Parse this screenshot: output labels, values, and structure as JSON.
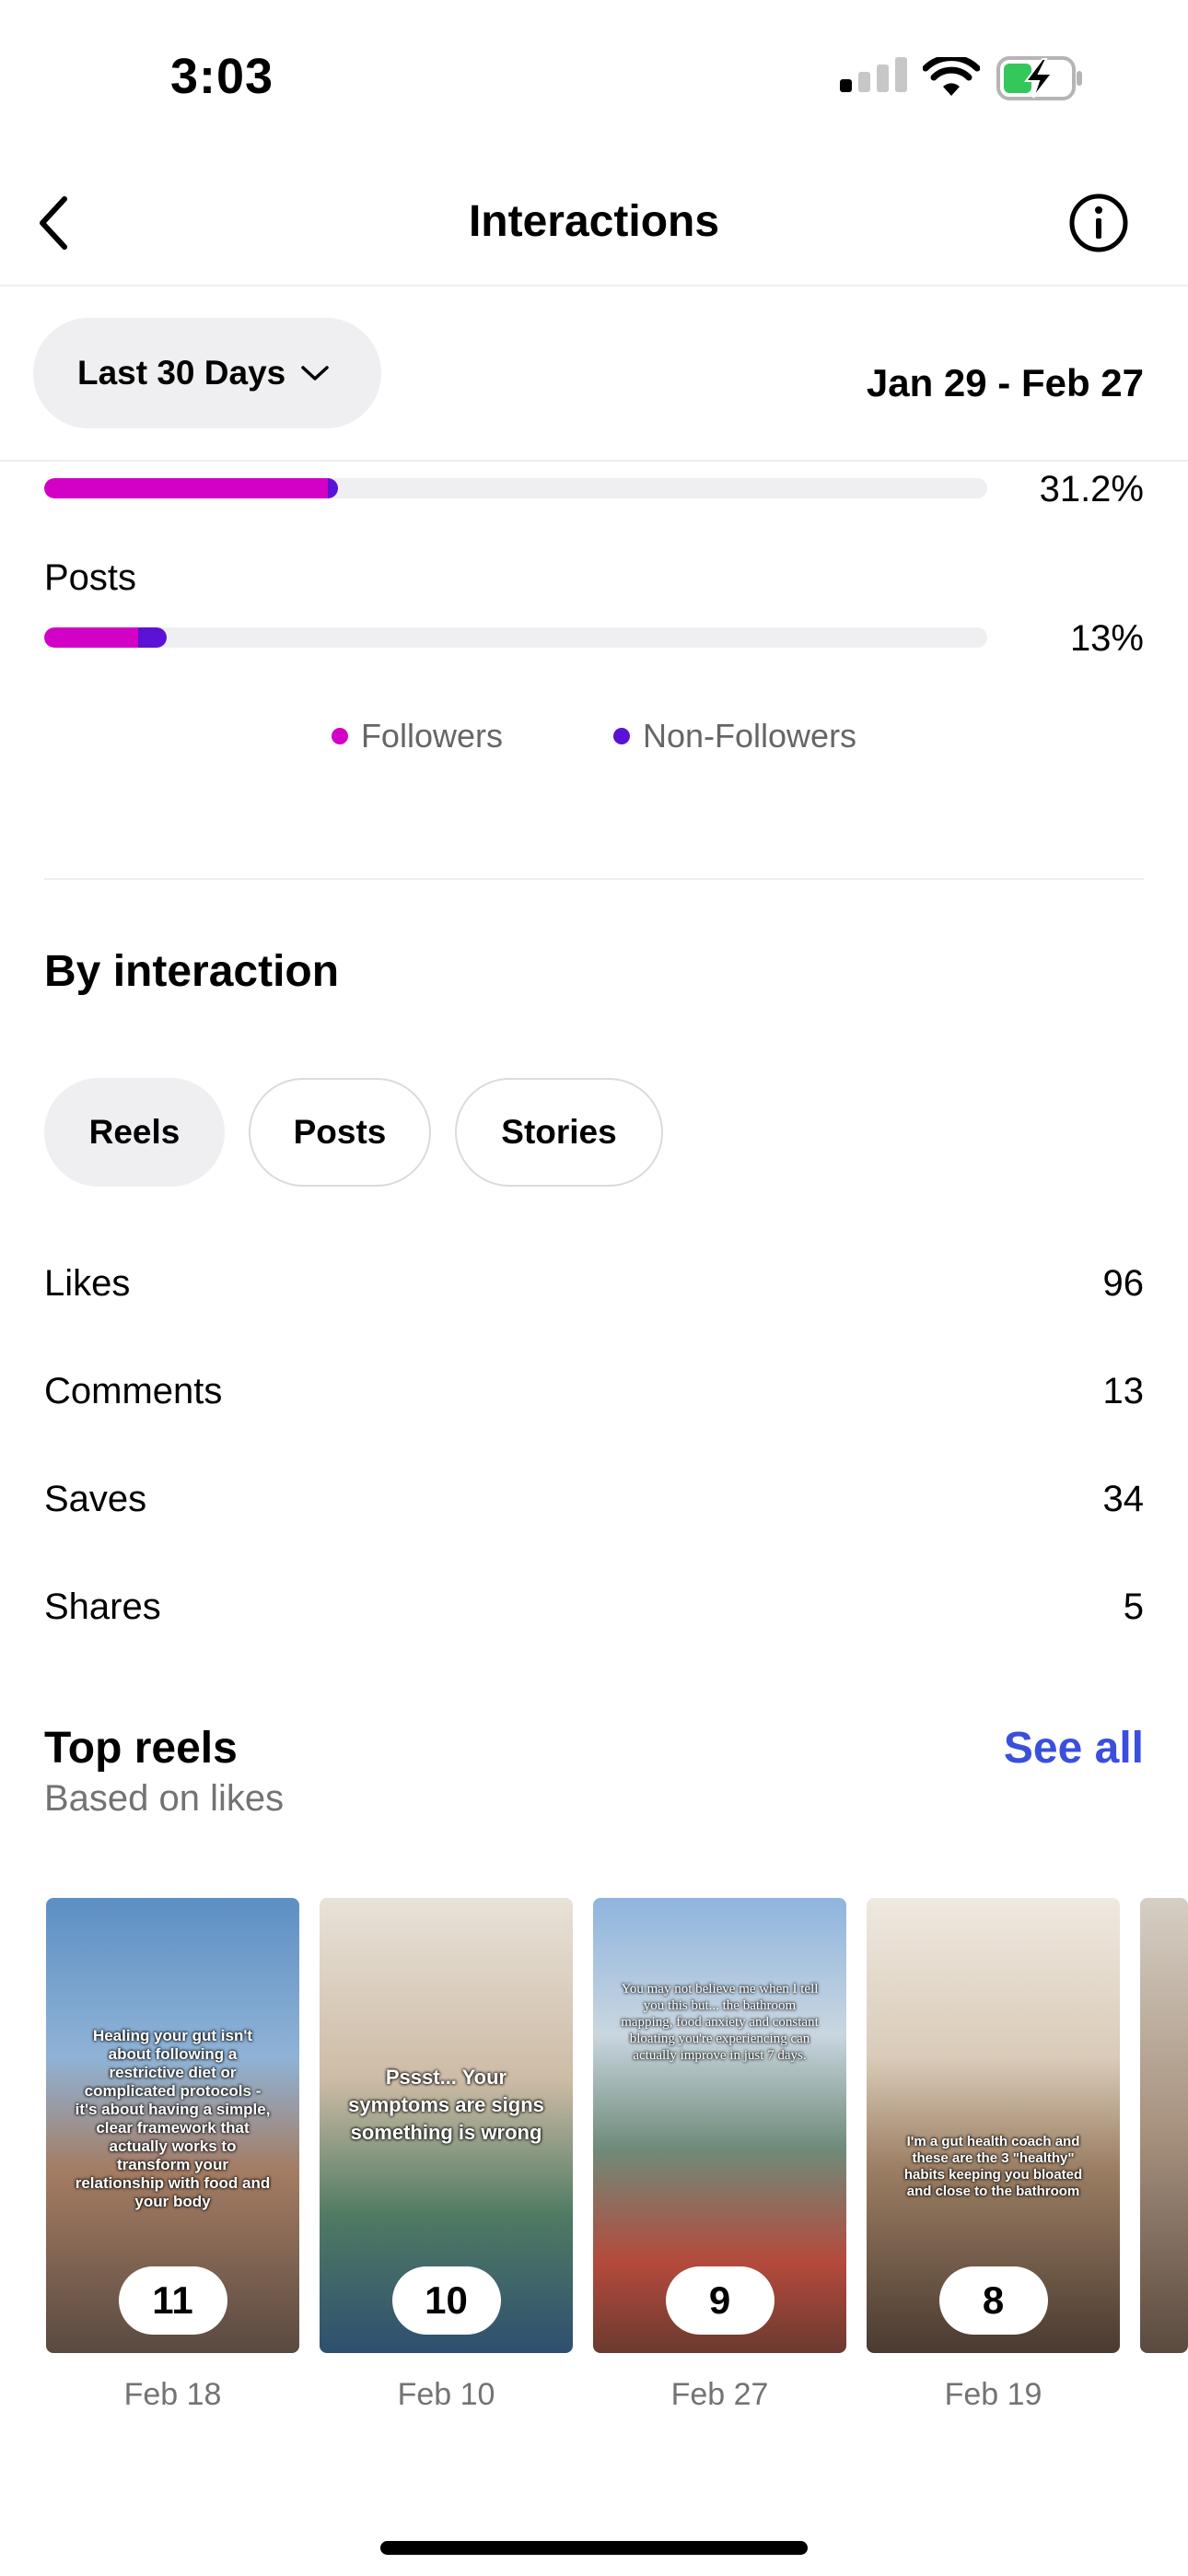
{
  "status_bar": {
    "time": "3:03"
  },
  "header": {
    "title": "Interactions"
  },
  "filter": {
    "period_label": "Last 30 Days",
    "date_range": "Jan 29 - Feb 27"
  },
  "audience_bars": [
    {
      "label": "",
      "followers_pct": 30.1,
      "non_followers_pct": 1.1,
      "total_text": "31.2%"
    },
    {
      "label": "Posts",
      "followers_pct": 10,
      "non_followers_pct": 3,
      "total_text": "13%"
    }
  ],
  "legend": {
    "followers": "Followers",
    "non_followers": "Non-Followers"
  },
  "colors": {
    "followers": "#d300c5",
    "non_followers": "#5b12d6",
    "link": "#3a4fdc",
    "track": "#efeff2"
  },
  "by_interaction": {
    "title": "By interaction",
    "tabs": [
      {
        "label": "Reels",
        "active": true
      },
      {
        "label": "Posts",
        "active": false
      },
      {
        "label": "Stories",
        "active": false
      }
    ],
    "metrics": [
      {
        "label": "Likes",
        "value": "96"
      },
      {
        "label": "Comments",
        "value": "13"
      },
      {
        "label": "Saves",
        "value": "34"
      },
      {
        "label": "Shares",
        "value": "5"
      }
    ]
  },
  "top_reels": {
    "title": "Top reels",
    "subtitle": "Based on likes",
    "see_all": "See all",
    "items": [
      {
        "count": "11",
        "date": "Feb 18",
        "caption": "Healing your gut isn't about following a restrictive diet or complicated protocols - it's about having a simple, clear framework that actually works to transform your relationship with food and your body"
      },
      {
        "count": "10",
        "date": "Feb 10",
        "caption": "Pssst... Your symptoms are signs something is wrong"
      },
      {
        "count": "9",
        "date": "Feb 27",
        "caption": "You may not believe me when I tell you this but... the bathroom mapping, food anxiety and constant bloating you're experiencing can actually improve in just 7 days."
      },
      {
        "count": "8",
        "date": "Feb 19",
        "caption": "I'm a gut health coach and these are the 3 \"healthy\" habits keeping you bloated and close to the bathroom"
      }
    ]
  }
}
